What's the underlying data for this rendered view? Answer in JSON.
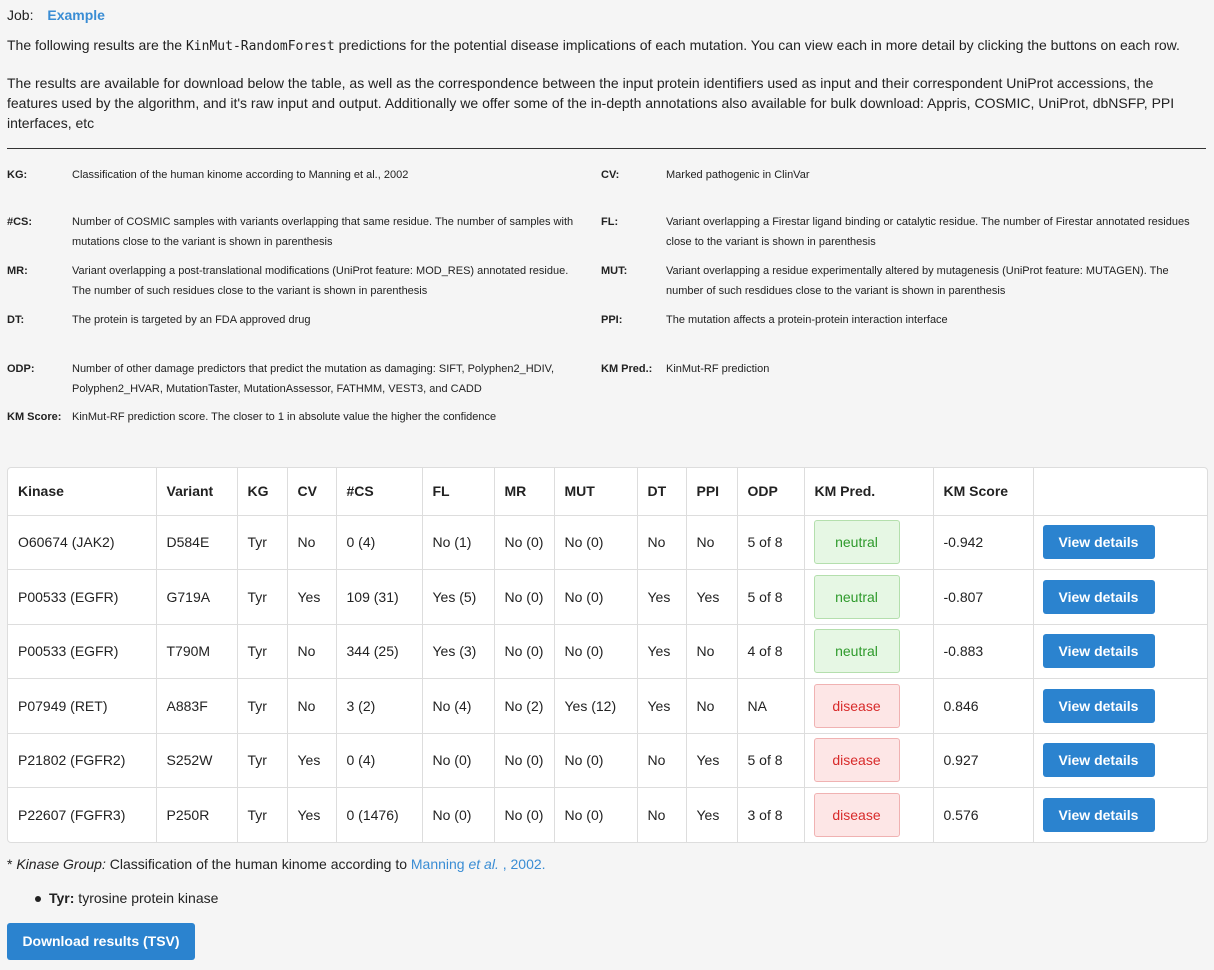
{
  "job": {
    "label": "Job:",
    "name": "Example"
  },
  "intro": {
    "p1_before": "The following results are the ",
    "p1_code": "KinMut-RandomForest",
    "p1_after": " predictions for the potential disease implications of each mutation. You can view each in more detail by clicking the buttons on each row.",
    "p2": "The results are available for download below the table, as well as the correspondence between the input protein identifiers used as input and their correspondent UniProt accessions, the features used by the algorithm, and it's raw input and output. Additionally we offer some of the in-depth annotations also available for bulk download: Appris, COSMIC, UniProt, dbNSFP, PPI interfaces, etc"
  },
  "legend": [
    {
      "key": "KG:",
      "desc": "Classification of the human kinome according to Manning et al., 2002"
    },
    {
      "key": "CV:",
      "desc": "Marked pathogenic in ClinVar"
    },
    {
      "key": "#CS:",
      "desc": "Number of COSMIC samples with variants overlapping that same residue. The number of samples with mutations close to the variant is shown in parenthesis"
    },
    {
      "key": "FL:",
      "desc": "Variant overlapping a Firestar ligand binding or catalytic residue. The number of Firestar annotated residues close to the variant is shown in parenthesis"
    },
    {
      "key": "MR:",
      "desc": "Variant overlapping a post-translational modifications (UniProt feature: MOD_RES) annotated residue. The number of such residues close to the variant is shown in parenthesis"
    },
    {
      "key": "MUT:",
      "desc": "Variant overlapping a residue experimentally altered by mutagenesis (UniProt feature: MUTAGEN). The number of such resdidues close to the variant is shown in parenthesis"
    },
    {
      "key": "DT:",
      "desc": "The protein is targeted by an FDA approved drug"
    },
    {
      "key": "PPI:",
      "desc": "The mutation affects a protein-protein interaction interface"
    },
    {
      "key": "ODP:",
      "desc": "Number of other damage predictors that predict the mutation as damaging: SIFT, Polyphen2_HDIV, Polyphen2_HVAR, MutationTaster, MutationAssessor, FATHMM, VEST3, and CADD"
    },
    {
      "key": "KM Pred.:",
      "desc": "KinMut-RF prediction"
    },
    {
      "key": "KM Score:",
      "desc": "KinMut-RF prediction score. The closer to 1 in absolute value the higher the confidence"
    }
  ],
  "table": {
    "headers": [
      "Kinase",
      "Variant",
      "KG",
      "CV",
      "#CS",
      "FL",
      "MR",
      "MUT",
      "DT",
      "PPI",
      "ODP",
      "KM Pred.",
      "KM Score",
      ""
    ],
    "rows": [
      [
        "O60674 (JAK2)",
        "D584E",
        "Tyr",
        "No",
        "0 (4)",
        "No (1)",
        "No (0)",
        "No (0)",
        "No",
        "No",
        "5 of 8",
        "neutral",
        "-0.942",
        "View details"
      ],
      [
        "P00533 (EGFR)",
        "G719A",
        "Tyr",
        "Yes",
        "109 (31)",
        "Yes (5)",
        "No (0)",
        "No (0)",
        "Yes",
        "Yes",
        "5 of 8",
        "neutral",
        "-0.807",
        "View details"
      ],
      [
        "P00533 (EGFR)",
        "T790M",
        "Tyr",
        "No",
        "344 (25)",
        "Yes (3)",
        "No (0)",
        "No (0)",
        "Yes",
        "No",
        "4 of 8",
        "neutral",
        "-0.883",
        "View details"
      ],
      [
        "P07949 (RET)",
        "A883F",
        "Tyr",
        "No",
        "3 (2)",
        "No (4)",
        "No (2)",
        "Yes (12)",
        "Yes",
        "No",
        "NA",
        "disease",
        "0.846",
        "View details"
      ],
      [
        "P21802 (FGFR2)",
        "S252W",
        "Tyr",
        "Yes",
        "0 (4)",
        "No (0)",
        "No (0)",
        "No (0)",
        "No",
        "Yes",
        "5 of 8",
        "disease",
        "0.927",
        "View details"
      ],
      [
        "P22607 (FGFR3)",
        "P250R",
        "Tyr",
        "Yes",
        "0 (1476)",
        "No (0)",
        "No (0)",
        "No (0)",
        "No",
        "Yes",
        "3 of 8",
        "disease",
        "0.576",
        "View details"
      ]
    ]
  },
  "footnote": {
    "star": "* ",
    "term": "Kinase Group:",
    "text": " Classification of the human kinome according to ",
    "link_a": "Manning ",
    "link_em": "et al.",
    "link_b": " , 2002."
  },
  "bullet": {
    "key": "Tyr:",
    "text": " tyrosine protein kinase"
  },
  "download_label": "Download results (TSV)",
  "colors": {
    "accent": "#2b83cf",
    "link": "#3a8dd4",
    "neutral": "#2e9a2b",
    "disease": "#d82a2a"
  }
}
